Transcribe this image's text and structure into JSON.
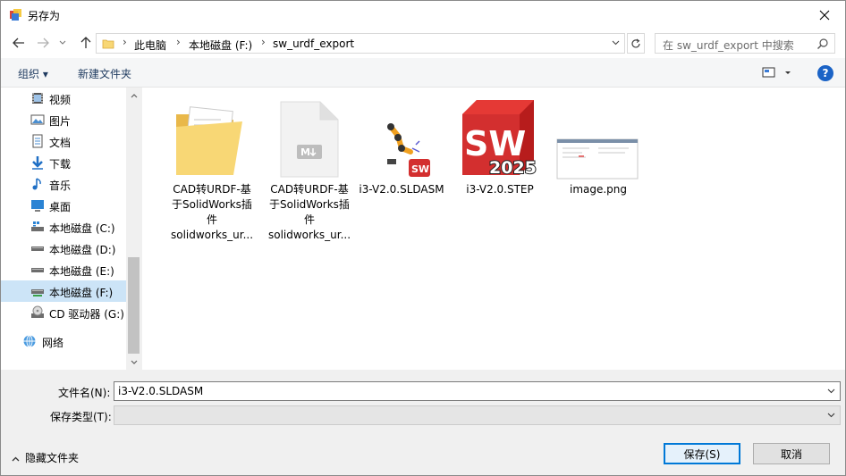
{
  "window": {
    "title": "另存为"
  },
  "nav": {
    "breadcrumbs": [
      "此电脑",
      "本地磁盘 (F:)",
      "sw_urdf_export"
    ],
    "search_placeholder": "在 sw_urdf_export 中搜索"
  },
  "toolbar": {
    "organize": "组织 ▾",
    "new_folder": "新建文件夹",
    "help": "?"
  },
  "sidebar": {
    "items": [
      {
        "label": "视频",
        "icon": "video-icon"
      },
      {
        "label": "图片",
        "icon": "pictures-icon"
      },
      {
        "label": "文档",
        "icon": "documents-icon"
      },
      {
        "label": "下载",
        "icon": "download-icon"
      },
      {
        "label": "音乐",
        "icon": "music-icon"
      },
      {
        "label": "桌面",
        "icon": "desktop-icon"
      },
      {
        "label": "本地磁盘 (C:)",
        "icon": "windows-drive-icon"
      },
      {
        "label": "本地磁盘 (D:)",
        "icon": "drive-icon"
      },
      {
        "label": "本地磁盘 (E:)",
        "icon": "drive-icon"
      },
      {
        "label": "本地磁盘 (F:)",
        "icon": "network-drive-icon",
        "selected": true
      },
      {
        "label": "CD 驱动器 (G:)",
        "icon": "cd-drive-icon"
      },
      {
        "label": "网络",
        "icon": "network-icon"
      }
    ]
  },
  "files": [
    {
      "name": "CAD转URDF-基于SolidWorks插件solidworks_ur...",
      "lines": [
        "CAD转URDF-基",
        "于SolidWorks插",
        "件",
        "solidworks_ur..."
      ],
      "icon": "folder-icon"
    },
    {
      "name": "CAD转URDF-基于SolidWorks插件solidworks_ur...",
      "lines": [
        "CAD转URDF-基",
        "于SolidWorks插",
        "件",
        "solidworks_ur..."
      ],
      "icon": "markdown-file-icon"
    },
    {
      "name": "i3-V2.0.SLDASM",
      "lines": [
        "i3-V2.0.SLDASM"
      ],
      "icon": "sldasm-robot-icon"
    },
    {
      "name": "i3-V2.0.STEP",
      "lines": [
        "i3-V2.0.STEP"
      ],
      "icon": "solidworks-2025-icon",
      "badge": "SW",
      "year": "2025"
    },
    {
      "name": "image.png",
      "lines": [
        "image.png"
      ],
      "icon": "image-thumbnail-icon"
    }
  ],
  "form": {
    "filename_label": "文件名(N):",
    "filename_value": "i3-V2.0.SLDASM",
    "filetype_label": "保存类型(T):",
    "filetype_value": ""
  },
  "footer": {
    "hide_folders": "隐藏文件夹",
    "save": "保存(S)",
    "cancel": "取消"
  }
}
